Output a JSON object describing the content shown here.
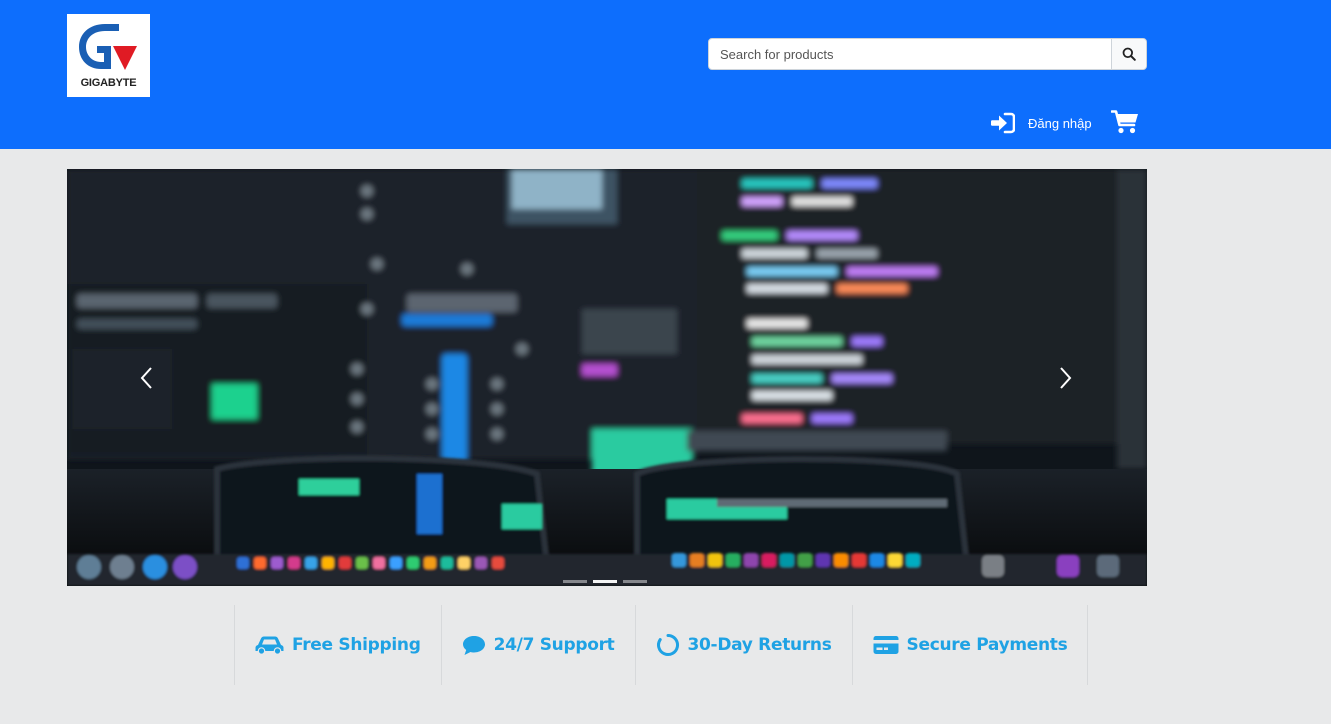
{
  "header": {
    "logo_text": "GIGABYTE",
    "search": {
      "placeholder": "Search for products",
      "value": ""
    },
    "login_label": "Đăng nhập"
  },
  "banner": {
    "slide_count": 3,
    "active_slide": 2
  },
  "features": [
    {
      "icon": "car-icon",
      "label": "Free Shipping"
    },
    {
      "icon": "chat-icon",
      "label": "24/7 Support"
    },
    {
      "icon": "circle-arrow-icon",
      "label": "30-Day Returns"
    },
    {
      "icon": "credit-card-icon",
      "label": "Secure Payments"
    }
  ],
  "colors": {
    "header_bg": "#0d6efd",
    "page_bg": "#e8e9ea",
    "feature_text": "#1fa2e4"
  }
}
